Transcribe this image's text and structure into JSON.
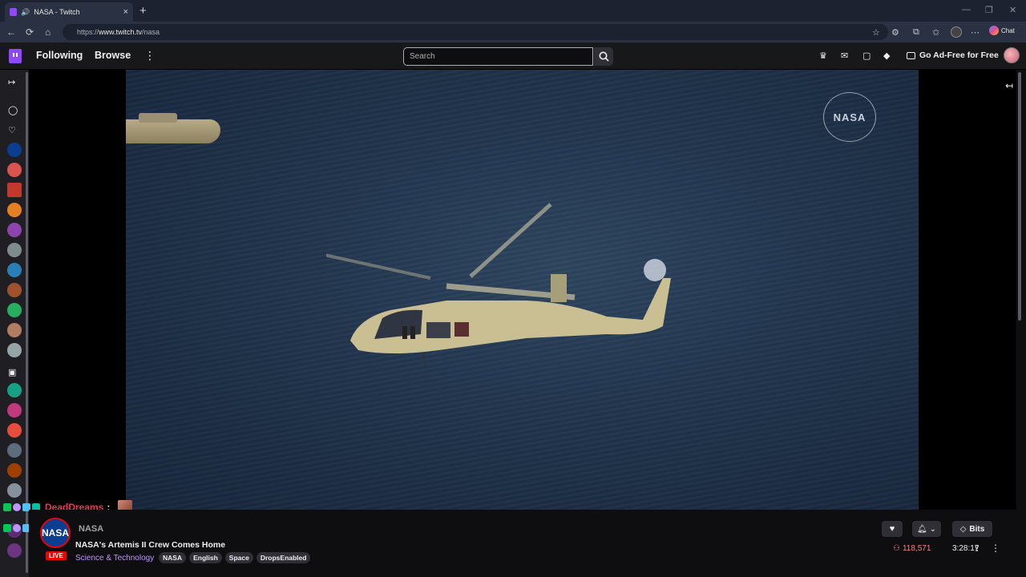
{
  "browser": {
    "tab_title": "NASA - Twitch",
    "url_prefix": "https://",
    "url_host": "www.twitch.tv",
    "url_path": "/nasa",
    "chat_label": "Chat"
  },
  "topnav": {
    "following": "Following",
    "browse": "Browse",
    "search_placeholder": "Search",
    "ad_free": "Go Ad-Free for Free"
  },
  "video": {
    "watermark": "NASA"
  },
  "chat_overlay": {
    "username": "DeadDreams",
    "colon": ":"
  },
  "channel": {
    "name": "NASA",
    "avatar_text": "NASA",
    "live_label": "LIVE",
    "title": "NASA's Artemis II Crew Comes Home",
    "category": "Science & Technology",
    "tags": [
      "NASA",
      "English",
      "Space",
      "DropsEnabled"
    ],
    "bits_label": "Bits",
    "viewers": "118,571",
    "uptime": "3:28:17"
  },
  "colors": {
    "twitch_purple": "#9146ff",
    "live_red": "#eb0400",
    "viewer_red": "#ff8280",
    "category_purple": "#bf94ff"
  }
}
